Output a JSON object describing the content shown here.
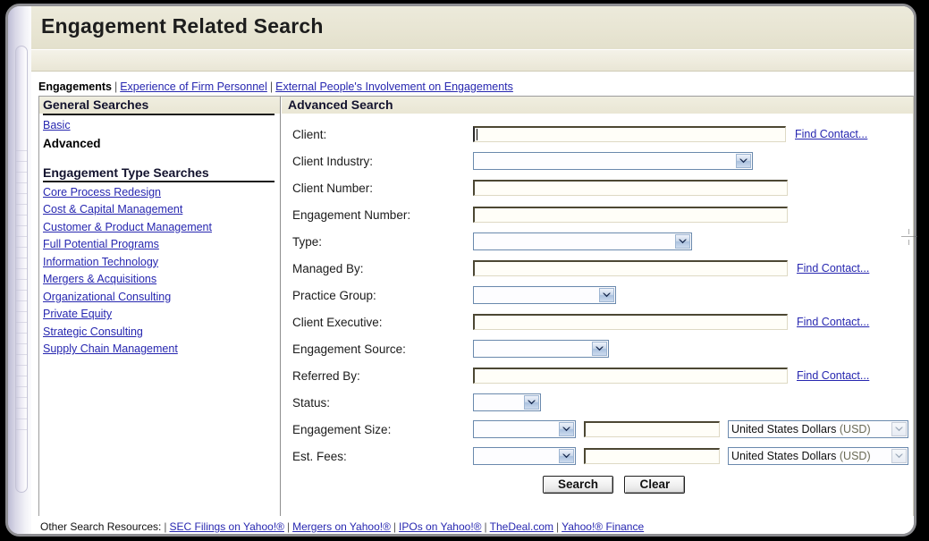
{
  "window": {
    "title": "Engagement Related Search"
  },
  "topnav": {
    "current": "Engagements",
    "separator": "|",
    "links": [
      "Experience of Firm Personnel",
      "External People's Involvement on Engagements"
    ]
  },
  "sidebar": {
    "general_header": "General Searches",
    "general_items": [
      {
        "label": "Basic",
        "active": false
      },
      {
        "label": "Advanced",
        "active": true
      }
    ],
    "type_header": "Engagement Type Searches",
    "type_items": [
      "Core Process Redesign",
      "Cost & Capital Management",
      "Customer & Product Management",
      "Full Potential Programs",
      "Information Technology",
      "Mergers & Acquisitions",
      "Organizational Consulting",
      "Private Equity",
      "Strategic Consulting",
      "Supply Chain Management"
    ]
  },
  "form": {
    "header": "Advanced Search",
    "find_contact_label": "Find Contact...",
    "fields": {
      "client": {
        "label": "Client:",
        "value": "",
        "type": "text"
      },
      "client_industry": {
        "label": "Client Industry:",
        "value": "",
        "type": "select"
      },
      "client_number": {
        "label": "Client Number:",
        "value": "",
        "type": "text"
      },
      "engagement_number": {
        "label": "Engagement Number:",
        "value": "",
        "type": "text"
      },
      "type": {
        "label": "Type:",
        "value": "",
        "type": "select"
      },
      "managed_by": {
        "label": "Managed By:",
        "value": "",
        "type": "text"
      },
      "practice_group": {
        "label": "Practice Group:",
        "value": "",
        "type": "select"
      },
      "client_executive": {
        "label": "Client Executive:",
        "value": "",
        "type": "text"
      },
      "engagement_source": {
        "label": "Engagement Source:",
        "value": "",
        "type": "select"
      },
      "referred_by": {
        "label": "Referred By:",
        "value": "",
        "type": "text"
      },
      "status": {
        "label": "Status:",
        "value": "",
        "type": "select"
      },
      "engagement_size": {
        "label": "Engagement Size:",
        "operator": "",
        "amount": "",
        "currency": "United States Dollars (USD)"
      },
      "est_fees": {
        "label": "Est. Fees:",
        "operator": "",
        "amount": "",
        "currency": "United States Dollars (USD)"
      }
    },
    "buttons": {
      "search": "Search",
      "clear": "Clear"
    }
  },
  "footer": {
    "label": "Other Search Resources:",
    "separator": "|",
    "links": [
      "SEC Filings on Yahoo!®",
      "Mergers on Yahoo!®",
      "IPOs on Yahoo!®",
      "TheDeal.com",
      "Yahoo!® Finance"
    ]
  },
  "colors": {
    "link": "#2727B0",
    "header_band": "#E8E5D3",
    "panel_head": "#EDEADC",
    "select_border": "#6A89AD",
    "input_border": "#4C4733"
  }
}
